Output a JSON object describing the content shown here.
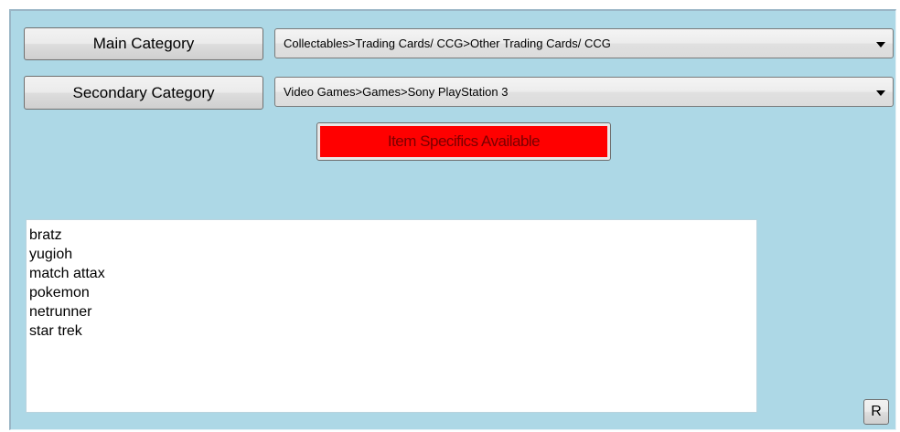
{
  "categories": {
    "main": {
      "button_label": "Main Category",
      "selected_value": "Collectables>Trading Cards/ CCG>Other Trading Cards/ CCG"
    },
    "secondary": {
      "button_label": "Secondary Category",
      "selected_value": "Video Games>Games>Sony PlayStation 3"
    }
  },
  "item_specifics": {
    "label": "Item Specifics Available",
    "color": "#ff0000"
  },
  "keywords_list": {
    "items": [
      "bratz",
      "yugioh",
      "match attax",
      "pokemon",
      "netrunner",
      "star trek"
    ]
  },
  "reset_button": {
    "label": "R"
  },
  "colors": {
    "panel_background": "#add8e6"
  }
}
